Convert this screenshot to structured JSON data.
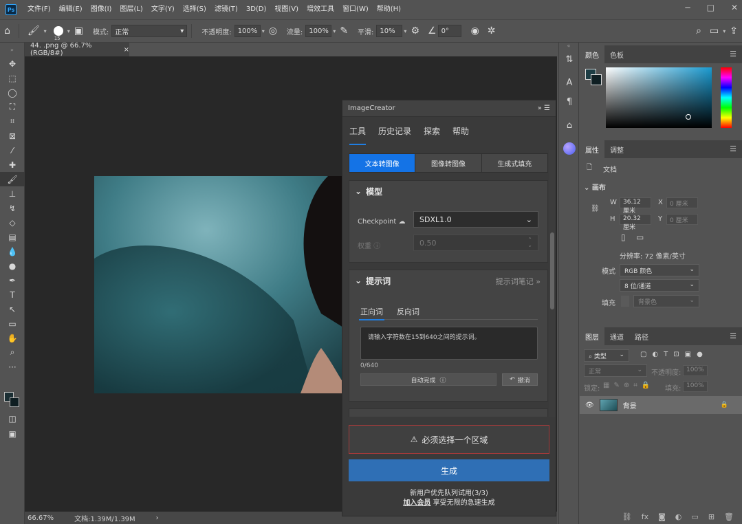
{
  "app": {
    "logo": "Ps"
  },
  "menu": [
    "文件(F)",
    "编辑(E)",
    "图像(I)",
    "图层(L)",
    "文字(Y)",
    "选择(S)",
    "滤镜(T)",
    "3D(D)",
    "视图(V)",
    "增效工具",
    "窗口(W)",
    "帮助(H)"
  ],
  "window_controls": {
    "minimize": "─",
    "restore": "□",
    "close": "✕"
  },
  "options": {
    "brush_size": "15",
    "mode_label": "模式:",
    "mode_value": "正常",
    "opacity_label": "不透明度:",
    "opacity_value": "100%",
    "flow_label": "流量:",
    "flow_value": "100%",
    "smoothing_label": "平滑:",
    "smoothing_value": "10%",
    "angle_value": "0°"
  },
  "document": {
    "tab_title": "44. .png @ 66.7%(RGB/8#)",
    "tab_close": "×",
    "zoom": "66.67%",
    "doc_info": "文档:1.39M/1.39M"
  },
  "image_creator": {
    "title": "ImageCreator",
    "tabs": [
      "工具",
      "历史记录",
      "探索",
      "帮助"
    ],
    "modes": [
      "文本转图像",
      "图像转图像",
      "生成式填充"
    ],
    "model_section": {
      "title": "模型",
      "checkpoint_label": "Checkpoint",
      "checkpoint_value": "SDXL1.0",
      "weight_label": "权重",
      "weight_value": "0.50"
    },
    "prompt_section": {
      "title": "提示词",
      "notes_link": "提示词笔记 »",
      "subtabs": [
        "正向词",
        "反向词"
      ],
      "placeholder": "请输入字符数在15到640之间的提示词。",
      "counter": "0/640",
      "autocomplete": "自动完成",
      "undo": "撤消"
    },
    "warning": "必须选择一个区域",
    "generate": "生成",
    "note_line1": "新用户优先队列试用(3/3)",
    "note_link": "加入会员",
    "note_rest": " 享受无限的急速生成"
  },
  "color_panel": {
    "tabs": [
      "颜色",
      "色板"
    ]
  },
  "properties_panel": {
    "tabs": [
      "属性",
      "调整"
    ],
    "doc_label": "文档",
    "canvas_label": "画布",
    "w_label": "W",
    "w_value": "36.12 厘米",
    "h_label": "H",
    "h_value": "20.32 厘米",
    "x_label": "X",
    "x_value": "0 厘米",
    "y_label": "Y",
    "y_value": "0 厘米",
    "resolution": "分辨率: 72 像素/英寸",
    "mode_label": "模式",
    "mode_value": "RGB 颜色",
    "depth_value": "8 位/通道",
    "bg_label": "填充",
    "bg_value": "背景色"
  },
  "layers_panel": {
    "tabs": [
      "图层",
      "通道",
      "路径"
    ],
    "filter_kind": "类型",
    "blend_mode": "正常",
    "opacity_label": "不透明度:",
    "opacity_value": "100%",
    "lock_label": "锁定:",
    "fill_label": "填充:",
    "fill_value": "100%",
    "layer_name": "背景"
  }
}
